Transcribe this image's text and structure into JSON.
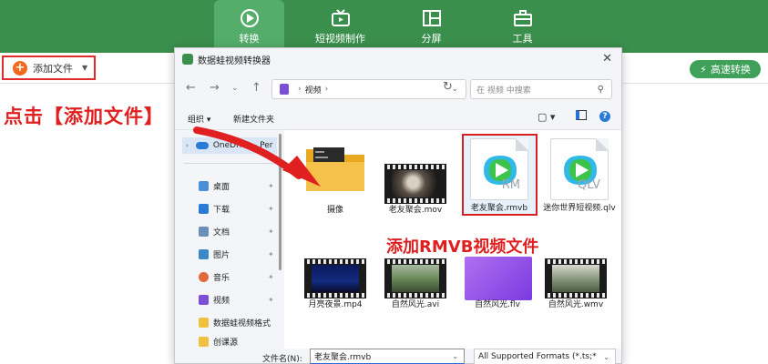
{
  "app": {
    "tabs": [
      {
        "label": "转换",
        "icon": "convert-icon",
        "active": true
      },
      {
        "label": "短视频制作",
        "icon": "video-maker-icon",
        "active": false
      },
      {
        "label": "分屏",
        "icon": "split-screen-icon",
        "active": false
      },
      {
        "label": "工具",
        "icon": "toolbox-icon",
        "active": false
      }
    ],
    "add_file_label": "添加文件",
    "fast_convert_label": "高速转换",
    "accent": "#3b8f4d"
  },
  "annotations": {
    "click_add_file": "点击【添加文件】",
    "add_rmvb": "添加RMVB视频文件"
  },
  "dialog": {
    "title": "数据蛙视频转换器",
    "address": {
      "folder": "视频"
    },
    "search_placeholder": "在 视频 中搜索",
    "organize_label": "组织",
    "new_folder_label": "新建文件夹",
    "nav": {
      "onedrive": "OneDrive - Per",
      "items": [
        {
          "label": "桌面",
          "icon": "desktop-icon",
          "color": "#4a90d9"
        },
        {
          "label": "下载",
          "icon": "download-icon",
          "color": "#2a7bd6"
        },
        {
          "label": "文档",
          "icon": "documents-icon",
          "color": "#6b8fb8"
        },
        {
          "label": "图片",
          "icon": "pictures-icon",
          "color": "#3a88c8"
        },
        {
          "label": "音乐",
          "icon": "music-icon",
          "color": "#e06a3a"
        },
        {
          "label": "视频",
          "icon": "videos-icon",
          "color": "#7b4fd6"
        },
        {
          "label": "数据蛙视频格式",
          "icon": "folder-icon",
          "color": "#f0c040"
        },
        {
          "label": "创课源",
          "icon": "folder-icon",
          "color": "#f0c040"
        }
      ]
    },
    "files": [
      {
        "name": "摄像",
        "kind": "folder"
      },
      {
        "name": "老友聚会.mov",
        "kind": "video"
      },
      {
        "name": "老友聚会.rmvb",
        "kind": "doc",
        "ext": "RM",
        "selected": true
      },
      {
        "name": "迷你世界短视频.qlv",
        "kind": "doc",
        "ext": "QLV"
      },
      {
        "name": "月亮夜景.mp4",
        "kind": "video"
      },
      {
        "name": "自然风光.avi",
        "kind": "video"
      },
      {
        "name": "自然风光.flv",
        "kind": "purple"
      },
      {
        "name": "自然风光.wmv",
        "kind": "video"
      }
    ],
    "filename_label": "文件名(N):",
    "filename_value": "老友聚会.rmvb",
    "filetype_value": "All Supported Formats (*.ts;*"
  }
}
